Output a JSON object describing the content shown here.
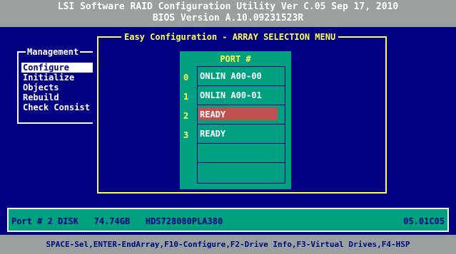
{
  "header": {
    "line1": "LSI Software RAID Configuration Utility Ver C.05 Sep 17, 2010",
    "line2": "BIOS Version   A.10.09231523R"
  },
  "management": {
    "title": "Management",
    "items": [
      {
        "label": "Configure",
        "selected": true
      },
      {
        "label": "Initialize",
        "selected": false
      },
      {
        "label": "Objects",
        "selected": false
      },
      {
        "label": "Rebuild",
        "selected": false
      },
      {
        "label": "Check Consist",
        "selected": false
      }
    ]
  },
  "dialog": {
    "title": "Easy Configuration - ARRAY SELECTION MENU",
    "port_header": "PORT #",
    "ports": [
      {
        "num": "0",
        "label": "ONLIN A00-00",
        "highlight": false
      },
      {
        "num": "1",
        "label": "ONLIN A00-01",
        "highlight": false
      },
      {
        "num": "2",
        "label": "READY",
        "highlight": true
      },
      {
        "num": "3",
        "label": "READY",
        "highlight": false
      },
      {
        "num": "",
        "label": "",
        "highlight": false
      },
      {
        "num": "",
        "label": "",
        "highlight": false
      }
    ]
  },
  "status": {
    "left": "Port # 2 DISK   74.74GB   HDS728080PLA380",
    "right": "05.01C05"
  },
  "footer": {
    "text": "SPACE-Sel,ENTER-EndArray,F10-Configure,F2-Drive Info,F3-Virtual Drives,F4-HSP"
  },
  "colors": {
    "background": "#000080",
    "header_bar": "#9aa0a0",
    "panel": "#00a080",
    "highlight": "#c05050",
    "accent_yellow": "#ffff55"
  }
}
